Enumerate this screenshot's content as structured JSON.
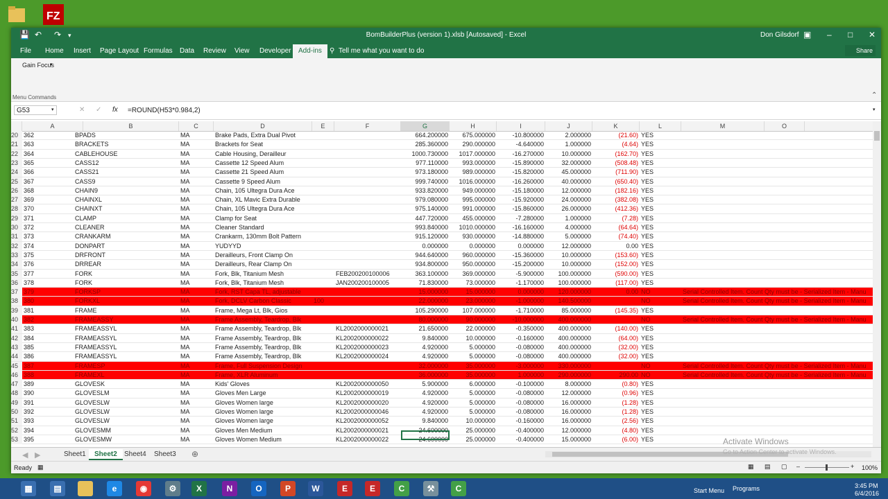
{
  "window": {
    "title": "BomBuilderPlus (version 1).xlsb [Autosaved] - Excel",
    "user": "Don Gilsdorf"
  },
  "ribbon": {
    "tabs": [
      "File",
      "Home",
      "Insert",
      "Page Layout",
      "Formulas",
      "Data",
      "Review",
      "View",
      "Developer",
      "Add-ins"
    ],
    "active_tab": "Add-ins",
    "tell_me": "Tell me what you want to do",
    "share": "Share",
    "gain_focus": "Gain Focus",
    "menu_commands": "Menu Commands"
  },
  "formula_bar": {
    "name_box": "G53",
    "formula": "=ROUND(H53*0.984,2)"
  },
  "columns": [
    "A",
    "B",
    "C",
    "D",
    "E",
    "F",
    "G",
    "H",
    "I",
    "J",
    "K",
    "L",
    "M",
    "O"
  ],
  "rows": [
    {
      "r": "20",
      "a": "362",
      "b": "BPADS",
      "c": "MA",
      "d": "Brake Pads, Extra Dual Pivot",
      "e": "",
      "f": "",
      "g": "664.200000",
      "h": "675.000000",
      "i": "-10.800000",
      "j": "2.000000",
      "k": "(21.60)",
      "l": "YES",
      "m": "",
      "err": false
    },
    {
      "r": "21",
      "a": "363",
      "b": "BRACKETS",
      "c": "MA",
      "d": "Brackets for Seat",
      "e": "",
      "f": "",
      "g": "285.360000",
      "h": "290.000000",
      "i": "-4.640000",
      "j": "1.000000",
      "k": "(4.64)",
      "l": "YES",
      "m": "",
      "err": false
    },
    {
      "r": "22",
      "a": "364",
      "b": "CABLEHOUSE",
      "c": "MA",
      "d": "Cable Housing, Derailleur",
      "e": "",
      "f": "",
      "g": "1000.730000",
      "h": "1017.000000",
      "i": "-16.270000",
      "j": "10.000000",
      "k": "(162.70)",
      "l": "YES",
      "m": "",
      "err": false
    },
    {
      "r": "23",
      "a": "365",
      "b": "CASS12",
      "c": "MA",
      "d": "Cassette 12 Speed Alum",
      "e": "",
      "f": "",
      "g": "977.110000",
      "h": "993.000000",
      "i": "-15.890000",
      "j": "32.000000",
      "k": "(508.48)",
      "l": "YES",
      "m": "",
      "err": false
    },
    {
      "r": "24",
      "a": "366",
      "b": "CASS21",
      "c": "MA",
      "d": "Cassette 21 Speed Alum",
      "e": "",
      "f": "",
      "g": "973.180000",
      "h": "989.000000",
      "i": "-15.820000",
      "j": "45.000000",
      "k": "(711.90)",
      "l": "YES",
      "m": "",
      "err": false
    },
    {
      "r": "25",
      "a": "367",
      "b": "CASS9",
      "c": "MA",
      "d": "Cassette 9 Speed Alum",
      "e": "",
      "f": "",
      "g": "999.740000",
      "h": "1016.000000",
      "i": "-16.260000",
      "j": "40.000000",
      "k": "(650.40)",
      "l": "YES",
      "m": "",
      "err": false
    },
    {
      "r": "26",
      "a": "368",
      "b": "CHAIN9",
      "c": "MA",
      "d": "Chain, 105 Ultegra Dura Ace",
      "e": "",
      "f": "",
      "g": "933.820000",
      "h": "949.000000",
      "i": "-15.180000",
      "j": "12.000000",
      "k": "(182.16)",
      "l": "YES",
      "m": "",
      "err": false
    },
    {
      "r": "27",
      "a": "369",
      "b": "CHAINXL",
      "c": "MA",
      "d": "Chain, XL Mavic Extra Durable",
      "e": "",
      "f": "",
      "g": "979.080000",
      "h": "995.000000",
      "i": "-15.920000",
      "j": "24.000000",
      "k": "(382.08)",
      "l": "YES",
      "m": "",
      "err": false
    },
    {
      "r": "28",
      "a": "370",
      "b": "CHAINXT",
      "c": "MA",
      "d": "Chain, 105 Ultegra Dura Ace",
      "e": "",
      "f": "",
      "g": "975.140000",
      "h": "991.000000",
      "i": "-15.860000",
      "j": "26.000000",
      "k": "(412.36)",
      "l": "YES",
      "m": "",
      "err": false
    },
    {
      "r": "29",
      "a": "371",
      "b": "CLAMP",
      "c": "MA",
      "d": "Clamp for Seat",
      "e": "",
      "f": "",
      "g": "447.720000",
      "h": "455.000000",
      "i": "-7.280000",
      "j": "1.000000",
      "k": "(7.28)",
      "l": "YES",
      "m": "",
      "err": false
    },
    {
      "r": "30",
      "a": "372",
      "b": "CLEANER",
      "c": "MA",
      "d": "Cleaner Standard",
      "e": "",
      "f": "",
      "g": "993.840000",
      "h": "1010.000000",
      "i": "-16.160000",
      "j": "4.000000",
      "k": "(64.64)",
      "l": "YES",
      "m": "",
      "err": false
    },
    {
      "r": "31",
      "a": "373",
      "b": "CRANKARM",
      "c": "MA",
      "d": "Crankarm, 130mm Bolt Pattern",
      "e": "",
      "f": "",
      "g": "915.120000",
      "h": "930.000000",
      "i": "-14.880000",
      "j": "5.000000",
      "k": "(74.40)",
      "l": "YES",
      "m": "",
      "err": false
    },
    {
      "r": "32",
      "a": "374",
      "b": "DONPART",
      "c": "MA",
      "d": "YUDYYD",
      "e": "",
      "f": "",
      "g": "0.000000",
      "h": "0.000000",
      "i": "0.000000",
      "j": "12.000000",
      "k": "0.00",
      "l": "YES",
      "m": "",
      "err": false
    },
    {
      "r": "33",
      "a": "375",
      "b": "DRFRONT",
      "c": "MA",
      "d": "Derailleurs, Front Clamp On",
      "e": "",
      "f": "",
      "g": "944.640000",
      "h": "960.000000",
      "i": "-15.360000",
      "j": "10.000000",
      "k": "(153.60)",
      "l": "YES",
      "m": "",
      "err": false
    },
    {
      "r": "34",
      "a": "376",
      "b": "DRREAR",
      "c": "MA",
      "d": "Derailleurs, Rear Clamp On",
      "e": "",
      "f": "",
      "g": "934.800000",
      "h": "950.000000",
      "i": "-15.200000",
      "j": "10.000000",
      "k": "(152.00)",
      "l": "YES",
      "m": "",
      "err": false
    },
    {
      "r": "35",
      "a": "377",
      "b": "FORK",
      "c": "MA",
      "d": "Fork, Blk, Titanium Mesh",
      "e": "",
      "f": "FEB200200100006",
      "g": "363.100000",
      "h": "369.000000",
      "i": "-5.900000",
      "j": "100.000000",
      "k": "(590.00)",
      "l": "YES",
      "m": "",
      "err": false
    },
    {
      "r": "36",
      "a": "378",
      "b": "FORK",
      "c": "MA",
      "d": "Fork, Blk, Titanium Mesh",
      "e": "",
      "f": "JAN200200100005",
      "g": "71.830000",
      "h": "73.000000",
      "i": "-1.170000",
      "j": "100.000000",
      "k": "(117.00)",
      "l": "YES",
      "m": "",
      "err": false
    },
    {
      "r": "37",
      "a": "379",
      "b": "FORKSP",
      "c": "MA",
      "d": "Fork, RST Capa TL, adjustable",
      "e": "",
      "f": "",
      "g": "15.000000",
      "h": "15.000000",
      "i": "0.000000",
      "j": "120.000000",
      "k": "0.00",
      "l": "NO",
      "m": "Serial Controlled Item. Count Qty must be - Serialized Item - Manu",
      "err": true
    },
    {
      "r": "38",
      "a": "380",
      "b": "FORKXL",
      "c": "MA",
      "d": "Fork, DCLV Carbon Classic",
      "e": "100",
      "f": "",
      "g": "22.000000",
      "h": "23.000000",
      "i": "-1.000000",
      "j": "140.500000",
      "k": "",
      "l": "NO",
      "m": "Serial Controlled Item. Count Qty must be - Serialized Item - Manu",
      "err": true
    },
    {
      "r": "39",
      "a": "381",
      "b": "FRAME",
      "c": "MA",
      "d": "Frame, Mega Lt, Blk, Gios",
      "e": "",
      "f": "",
      "g": "105.290000",
      "h": "107.000000",
      "i": "-1.710000",
      "j": "85.000000",
      "k": "(145.35)",
      "l": "YES",
      "m": "",
      "err": false
    },
    {
      "r": "40",
      "a": "382",
      "b": "FRAMEASSY",
      "c": "MA",
      "d": "Frame Assembly, Teardrop, Blk",
      "e": "",
      "f": "",
      "g": "80.000000",
      "h": "90.000000",
      "i": "-10.000000",
      "j": "400.000000",
      "k": "",
      "l": "NO",
      "m": "Serial Controlled Item. Count Qty must be - Serialized Item - Manu",
      "err": true
    },
    {
      "r": "41",
      "a": "383",
      "b": "FRAMEASSYL",
      "c": "MA",
      "d": "Frame Assembly, Teardrop, Blk",
      "e": "",
      "f": "KL2002000000021",
      "g": "21.650000",
      "h": "22.000000",
      "i": "-0.350000",
      "j": "400.000000",
      "k": "(140.00)",
      "l": "YES",
      "m": "",
      "err": false
    },
    {
      "r": "42",
      "a": "384",
      "b": "FRAMEASSYL",
      "c": "MA",
      "d": "Frame Assembly, Teardrop, Blk",
      "e": "",
      "f": "KL2002000000022",
      "g": "9.840000",
      "h": "10.000000",
      "i": "-0.160000",
      "j": "400.000000",
      "k": "(64.00)",
      "l": "YES",
      "m": "",
      "err": false
    },
    {
      "r": "43",
      "a": "385",
      "b": "FRAMEASSYL",
      "c": "MA",
      "d": "Frame Assembly, Teardrop, Blk",
      "e": "",
      "f": "KL2002000000023",
      "g": "4.920000",
      "h": "5.000000",
      "i": "-0.080000",
      "j": "400.000000",
      "k": "(32.00)",
      "l": "YES",
      "m": "",
      "err": false
    },
    {
      "r": "44",
      "a": "386",
      "b": "FRAMEASSYL",
      "c": "MA",
      "d": "Frame Assembly, Teardrop, Blk",
      "e": "",
      "f": "KL2002000000024",
      "g": "4.920000",
      "h": "5.000000",
      "i": "-0.080000",
      "j": "400.000000",
      "k": "(32.00)",
      "l": "YES",
      "m": "",
      "err": false
    },
    {
      "r": "45",
      "a": "387",
      "b": "FRAMESP",
      "c": "MA",
      "d": "Frame, Full Suspension Design",
      "e": "",
      "f": "",
      "g": "32.000000",
      "h": "35.000000",
      "i": "-3.000000",
      "j": "330.000000",
      "k": "",
      "l": "NO",
      "m": "Serial Controlled Item. Count Qty must be - Serialized Item - Manu",
      "err": true
    },
    {
      "r": "46",
      "a": "388",
      "b": "FRAMEXL",
      "c": "MA",
      "d": "Frame, XLR Aluminum",
      "e": "",
      "f": "",
      "g": "36.000000",
      "h": "35.000000",
      "i": "1.000000",
      "j": "290.000000",
      "k": "290.00",
      "l": "NO",
      "m": "Serial Controlled Item. Count Qty must be - Serialized Item - Manu",
      "err": true
    },
    {
      "r": "47",
      "a": "389",
      "b": "GLOVESK",
      "c": "MA",
      "d": "Kids' Gloves",
      "e": "",
      "f": "KL2002000000050",
      "g": "5.900000",
      "h": "6.000000",
      "i": "-0.100000",
      "j": "8.000000",
      "k": "(0.80)",
      "l": "YES",
      "m": "",
      "err": false
    },
    {
      "r": "48",
      "a": "390",
      "b": "GLOVESLM",
      "c": "MA",
      "d": "Gloves Men Large",
      "e": "",
      "f": "KL2002000000019",
      "g": "4.920000",
      "h": "5.000000",
      "i": "-0.080000",
      "j": "12.000000",
      "k": "(0.96)",
      "l": "YES",
      "m": "",
      "err": false
    },
    {
      "r": "49",
      "a": "391",
      "b": "GLOVESLW",
      "c": "MA",
      "d": "Gloves Women large",
      "e": "",
      "f": "KL2002000000020",
      "g": "4.920000",
      "h": "5.000000",
      "i": "-0.080000",
      "j": "16.000000",
      "k": "(1.28)",
      "l": "YES",
      "m": "",
      "err": false
    },
    {
      "r": "50",
      "a": "392",
      "b": "GLOVESLW",
      "c": "MA",
      "d": "Gloves Women large",
      "e": "",
      "f": "KL2002000000046",
      "g": "4.920000",
      "h": "5.000000",
      "i": "-0.080000",
      "j": "16.000000",
      "k": "(1.28)",
      "l": "YES",
      "m": "",
      "err": false
    },
    {
      "r": "51",
      "a": "393",
      "b": "GLOVESLW",
      "c": "MA",
      "d": "Gloves Women large",
      "e": "",
      "f": "KL2002000000052",
      "g": "9.840000",
      "h": "10.000000",
      "i": "-0.160000",
      "j": "16.000000",
      "k": "(2.56)",
      "l": "YES",
      "m": "",
      "err": false
    },
    {
      "r": "52",
      "a": "394",
      "b": "GLOVESMM",
      "c": "MA",
      "d": "Gloves Men Medium",
      "e": "",
      "f": "KL2002000000021",
      "g": "24.600000",
      "h": "25.000000",
      "i": "-0.400000",
      "j": "12.000000",
      "k": "(4.80)",
      "l": "YES",
      "m": "",
      "err": false
    },
    {
      "r": "53",
      "a": "395",
      "b": "GLOVESMW",
      "c": "MA",
      "d": "Gloves Women Medium",
      "e": "",
      "f": "KL2002000000022",
      "g": "24.600000",
      "h": "25.000000",
      "i": "-0.400000",
      "j": "15.000000",
      "k": "(6.00)",
      "l": "YES",
      "m": "",
      "err": false
    }
  ],
  "sheet_tabs": [
    "Sheet1",
    "Sheet2",
    "Sheet4",
    "Sheet3"
  ],
  "active_sheet": "Sheet2",
  "status": {
    "ready": "Ready",
    "zoom": "100%"
  },
  "watermark": {
    "title": "Activate Windows",
    "subtitle": "Go to Action Center to activate Windows."
  },
  "taskbar": {
    "start_menu": "Start Menu",
    "programs": "Programs",
    "time": "3:45 PM",
    "date": "6/4/2016"
  },
  "colors": {
    "excel_green": "#217346",
    "error_red": "#ff0000",
    "negative": "#dd0000"
  }
}
